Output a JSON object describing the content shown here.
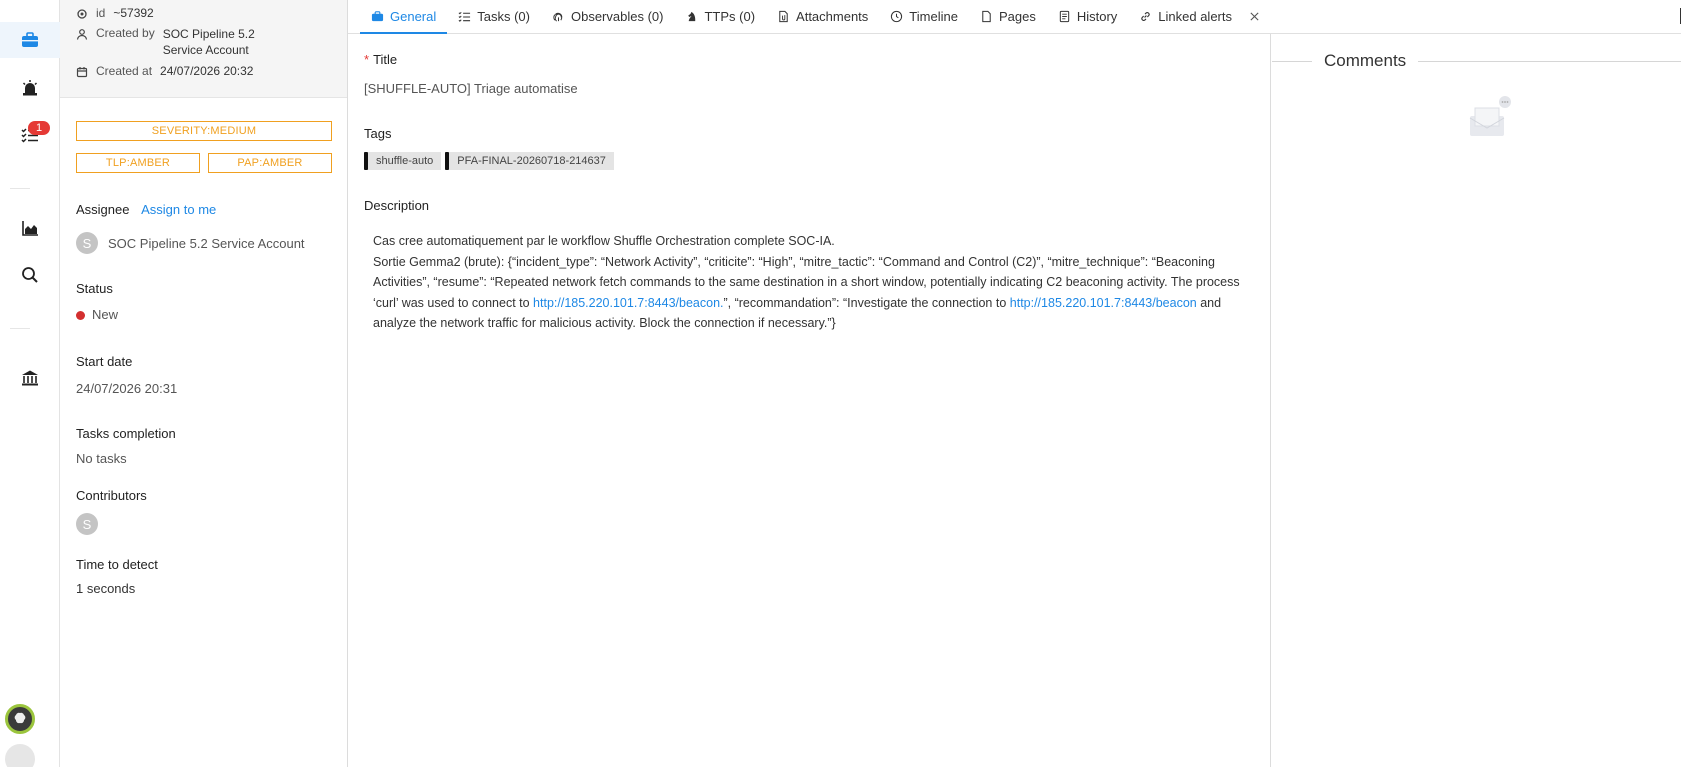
{
  "meta": {
    "id_label": "id",
    "id_value": "~57392",
    "created_by_label": "Created by",
    "created_by_value": "SOC Pipeline 5.2 Service Account",
    "created_at_label": "Created at",
    "created_at_value": "24/07/2026 20:32"
  },
  "badges": {
    "severity": "SEVERITY:MEDIUM",
    "tlp": "TLP:AMBER",
    "pap": "PAP:AMBER",
    "color": "#f0a020"
  },
  "rail": {
    "notification_count": "1"
  },
  "assignee": {
    "label": "Assignee",
    "action": "Assign to me",
    "avatar_letter": "S",
    "name": "SOC Pipeline 5.2 Service Account"
  },
  "status": {
    "label": "Status",
    "value": "New",
    "color": "#d32f2f"
  },
  "start_date": {
    "label": "Start date",
    "value": "24/07/2026 20:31"
  },
  "tasks_completion": {
    "label": "Tasks completion",
    "value": "No tasks"
  },
  "contributors": {
    "label": "Contributors",
    "avatar_letter": "S"
  },
  "time_to_detect": {
    "label": "Time to detect",
    "value": "1 seconds"
  },
  "tabs": [
    {
      "label": "General",
      "icon": "briefcase-icon",
      "active": true
    },
    {
      "label": "Tasks (0)",
      "icon": "tasks-icon"
    },
    {
      "label": "Observables (0)",
      "icon": "fingerprint-icon"
    },
    {
      "label": "TTPs (0)",
      "icon": "chess-knight-icon"
    },
    {
      "label": "Attachments",
      "icon": "paperclip-file-icon"
    },
    {
      "label": "Timeline",
      "icon": "clock-icon"
    },
    {
      "label": "Pages",
      "icon": "page-icon"
    },
    {
      "label": "History",
      "icon": "history-icon"
    },
    {
      "label": "Linked alerts",
      "icon": "link-icon"
    }
  ],
  "general": {
    "title_label": "Title",
    "title_value": "[SHUFFLE-AUTO] Triage automatise",
    "tags_label": "Tags",
    "tags": [
      "shuffle-auto",
      "PFA-FINAL-20260718-214637"
    ],
    "description_label": "Description",
    "description": {
      "line1": "Cas cree automatiquement par le workflow Shuffle Orchestration complete SOC-IA.",
      "part1": "Sortie Gemma2 (brute): {“incident_type”: “Network Activity”, “criticite”: “High”, “mitre_tactic”: “Command and Control (C2)”, “mitre_technique”: “Beaconing Activities”, “resume”: “Repeated network fetch commands to the same destination in a short window, potentially indicating C2 beaconing activity. The process ‘curl’ was used to connect to ",
      "link1": "http://185.220.101.7:8443/beacon.",
      "part2": "”, “recommandation”: “Investigate the connection to ",
      "link2": "http://185.220.101.7:8443/beacon",
      "part3": " and analyze the network traffic for malicious activity. Block the connection if necessary.”}"
    }
  },
  "comments": {
    "title": "Comments"
  }
}
